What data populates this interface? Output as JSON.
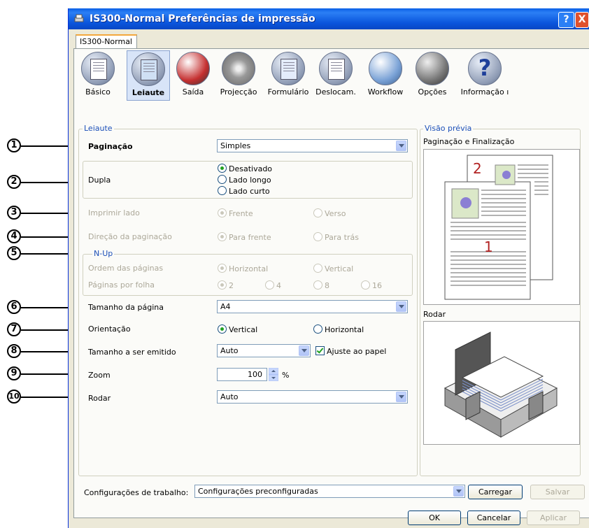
{
  "window": {
    "title": "IS300-Normal Preferências de impressão",
    "help_label": "?",
    "close_label": "X"
  },
  "tab": {
    "label": "IS300-Normal"
  },
  "toolbar": {
    "items": [
      {
        "label": "Básico"
      },
      {
        "label": "Leiaute"
      },
      {
        "label": "Saída"
      },
      {
        "label": "Projecção"
      },
      {
        "label": "Formulário"
      },
      {
        "label": "Deslocam."
      },
      {
        "label": "Workflow"
      },
      {
        "label": "Opções"
      },
      {
        "label": "Informação ı"
      }
    ]
  },
  "layout_group": {
    "title": "Leiaute"
  },
  "pagination": {
    "label": "Paginação",
    "value": "Simples"
  },
  "duplex": {
    "label": "Dupla",
    "options": [
      "Desativado",
      "Lado longo",
      "Lado curto"
    ],
    "selected": "Desativado"
  },
  "print_side": {
    "label": "Imprimir lado",
    "options": [
      "Frente",
      "Verso"
    ]
  },
  "page_direction": {
    "label": "Direção da paginação",
    "options": [
      "Para frente",
      "Para trás"
    ]
  },
  "nup": {
    "title": "N-Up",
    "order_label": "Ordem das páginas",
    "order_options": [
      "Horizontal",
      "Vertical"
    ],
    "per_sheet_label": "Páginas por folha",
    "per_sheet_options": [
      "2",
      "4",
      "8",
      "16"
    ]
  },
  "page_size": {
    "label": "Tamanho da página",
    "value": "A4"
  },
  "orientation": {
    "label": "Orientação",
    "options": [
      "Vertical",
      "Horizontal"
    ],
    "selected": "Vertical"
  },
  "output_size": {
    "label": "Tamanho a ser emitido",
    "value": "Auto",
    "fit_label": "Ajuste ao papel",
    "fit_checked": true
  },
  "zoom": {
    "label": "Zoom",
    "value": "100",
    "unit": "%"
  },
  "rotate": {
    "label": "Rodar",
    "value": "Auto"
  },
  "preview": {
    "title": "Visão prévia",
    "pagination_label": "Paginação e Finalização",
    "page_numbers": [
      "2",
      "1"
    ],
    "rotate_label": "Rodar"
  },
  "job_settings": {
    "label": "Configurações de trabalho:",
    "value": "Configurações preconfiguradas",
    "load_label": "Carregar",
    "save_label": "Salvar"
  },
  "footer": {
    "ok_label": "OK",
    "cancel_label": "Cancelar",
    "apply_label": "Aplicar"
  },
  "callouts": [
    "1",
    "2",
    "3",
    "4",
    "5",
    "6",
    "7",
    "8",
    "9",
    "10"
  ],
  "colors": {
    "title_bar": "#0a55dc",
    "group_title": "#1b4fb8",
    "page_number": "#b22222"
  }
}
